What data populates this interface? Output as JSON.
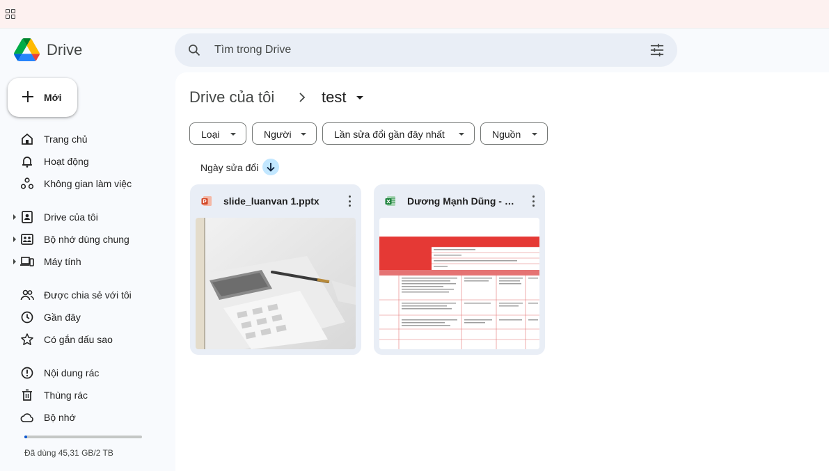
{
  "app": {
    "name": "Drive"
  },
  "search": {
    "placeholder": "Tìm trong Drive"
  },
  "new_button": {
    "label": "Mới"
  },
  "sidebar": {
    "items": [
      {
        "label": "Trang chủ",
        "icon": "home-icon"
      },
      {
        "label": "Hoạt động",
        "icon": "bell-icon"
      },
      {
        "label": "Không gian làm việc",
        "icon": "workspace-icon"
      },
      {
        "label": "Drive của tôi",
        "icon": "my-drive-icon",
        "expandable": true
      },
      {
        "label": "Bộ nhớ dùng chung",
        "icon": "shared-drive-icon",
        "expandable": true
      },
      {
        "label": "Máy tính",
        "icon": "computer-icon",
        "expandable": true
      },
      {
        "label": "Được chia sẻ với tôi",
        "icon": "people-icon"
      },
      {
        "label": "Gần đây",
        "icon": "clock-icon"
      },
      {
        "label": "Có gắn dấu sao",
        "icon": "star-icon"
      },
      {
        "label": "Nội dung rác",
        "icon": "spam-icon"
      },
      {
        "label": "Thùng rác",
        "icon": "trash-icon"
      },
      {
        "label": "Bộ nhớ",
        "icon": "cloud-icon"
      }
    ]
  },
  "storage": {
    "used_text": "Đã dùng 45,31 GB/2 TB",
    "used_fraction": 0.022
  },
  "breadcrumb": {
    "root": "Drive của tôi",
    "current": "test"
  },
  "filters": [
    {
      "label": "Loại"
    },
    {
      "label": "Người"
    },
    {
      "label": "Lần sửa đổi gần đây nhất"
    },
    {
      "label": "Nguồn"
    }
  ],
  "sort": {
    "label": "Ngày sửa đổi",
    "direction": "descending"
  },
  "files": [
    {
      "name": "slide_luanvan 1.pptx",
      "type": "powerpoint",
      "icon": "powerpoint-icon"
    },
    {
      "name": "Dương Mạnh Dũng - b...",
      "type": "excel",
      "icon": "excel-icon"
    }
  ],
  "colors": {
    "accent": "#0b57d0",
    "search_bg": "#e9eef6",
    "sort_chip": "#c2e7ff",
    "powerpoint": "#d24726",
    "excel": "#188038"
  }
}
